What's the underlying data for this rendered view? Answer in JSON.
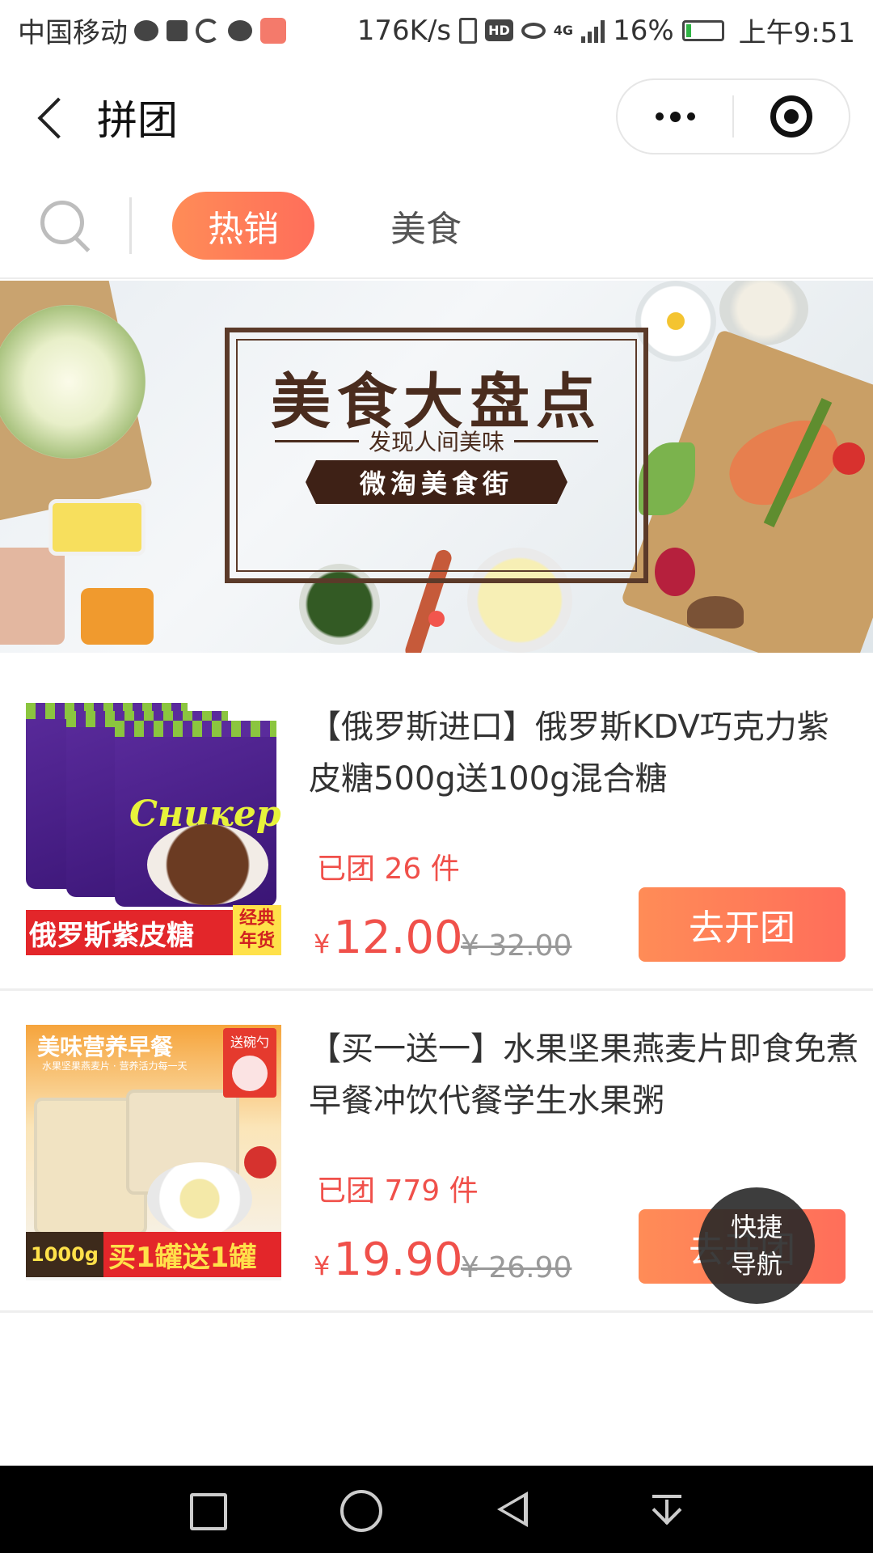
{
  "status_bar": {
    "carrier": "中国移动",
    "speed": "176K/s",
    "hd": "HD",
    "network": "4G",
    "battery": "16%",
    "battery_level": 0.16,
    "time": "上午9:51"
  },
  "header": {
    "title": "拼团"
  },
  "tabs": [
    {
      "label": "热销",
      "active": true
    },
    {
      "label": "美食",
      "active": false
    }
  ],
  "banner": {
    "title": "美食大盘点",
    "subtitle": "发现人间美味",
    "ribbon": "微淘美食街"
  },
  "products": [
    {
      "name": "【俄罗斯进口】俄罗斯KDV巧克力紫皮糖500g送100g混合糖",
      "sold": "已团 26 件",
      "currency": "¥",
      "price": "12.00",
      "original_price": "¥ 32.00",
      "button": "去开团",
      "thumb_brand": "Сникер",
      "thumb_caption": "俄罗斯紫皮糖",
      "thumb_tag": "经典年货"
    },
    {
      "name": "【买一送一】水果坚果燕麦片即食免煮早餐冲饮代餐学生水果粥",
      "sold": "已团 779 件",
      "currency": "¥",
      "price": "19.90",
      "original_price": "¥ 26.90",
      "button": "去开团",
      "thumb_title": "美味营养早餐",
      "thumb_small": "水果坚果燕麦片 · 营养活力每一天",
      "thumb_gift": "送碗勺",
      "thumb_weight": "1000g",
      "thumb_caption": "买1罐送1罐"
    }
  ],
  "fab": {
    "line1": "快捷",
    "line2": "导航"
  }
}
